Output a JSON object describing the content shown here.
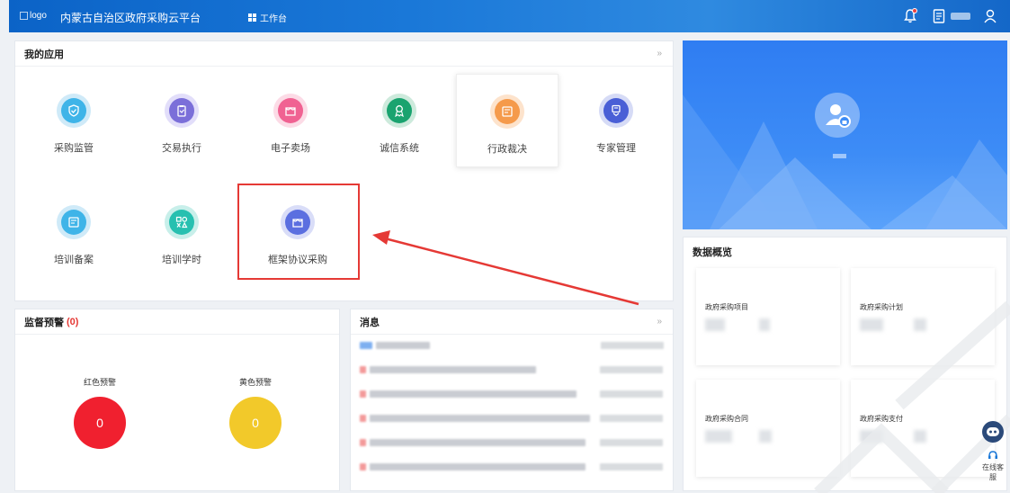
{
  "header": {
    "logo_alt": "logo",
    "platform_title": "内蒙古自治区政府采购云平台",
    "workbench_label": "工作台"
  },
  "apps": {
    "title": "我的应用",
    "more": "»",
    "items": [
      {
        "label": "采购监管",
        "icon": "shield-icon",
        "color": "#3fb4e8"
      },
      {
        "label": "交易执行",
        "icon": "clipboard-icon",
        "color": "#7b6fd9"
      },
      {
        "label": "电子卖场",
        "icon": "store-icon",
        "color": "#f06292"
      },
      {
        "label": "诚信系统",
        "icon": "ribbon-icon",
        "color": "#1aa36f"
      },
      {
        "label": "行政裁决",
        "icon": "ruling-icon",
        "color": "#f59a4b"
      },
      {
        "label": "专家管理",
        "icon": "expert-icon",
        "color": "#4a5fd6"
      },
      {
        "label": "培训备案",
        "icon": "record-icon",
        "color": "#3fb4e8"
      },
      {
        "label": "培训学时",
        "icon": "shapes-icon",
        "color": "#27c0b0"
      },
      {
        "label": "框架协议采购",
        "icon": "store-icon",
        "color": "#5b6fe0"
      }
    ]
  },
  "warning": {
    "title": "监督预警",
    "count": "(0)",
    "red_label": "红色预警",
    "red_value": "0",
    "yellow_label": "黄色预警",
    "yellow_value": "0",
    "red_color": "#f0202f",
    "yellow_color": "#f2c92a"
  },
  "messages": {
    "title": "消息",
    "more": "»"
  },
  "overview": {
    "title": "数据概览",
    "cards": [
      {
        "label": "政府采购项目"
      },
      {
        "label": "政府采购计划"
      },
      {
        "label": "政府采购合同"
      },
      {
        "label": "政府采购支付"
      }
    ]
  },
  "side_widget": {
    "online_label": "在线客服"
  }
}
